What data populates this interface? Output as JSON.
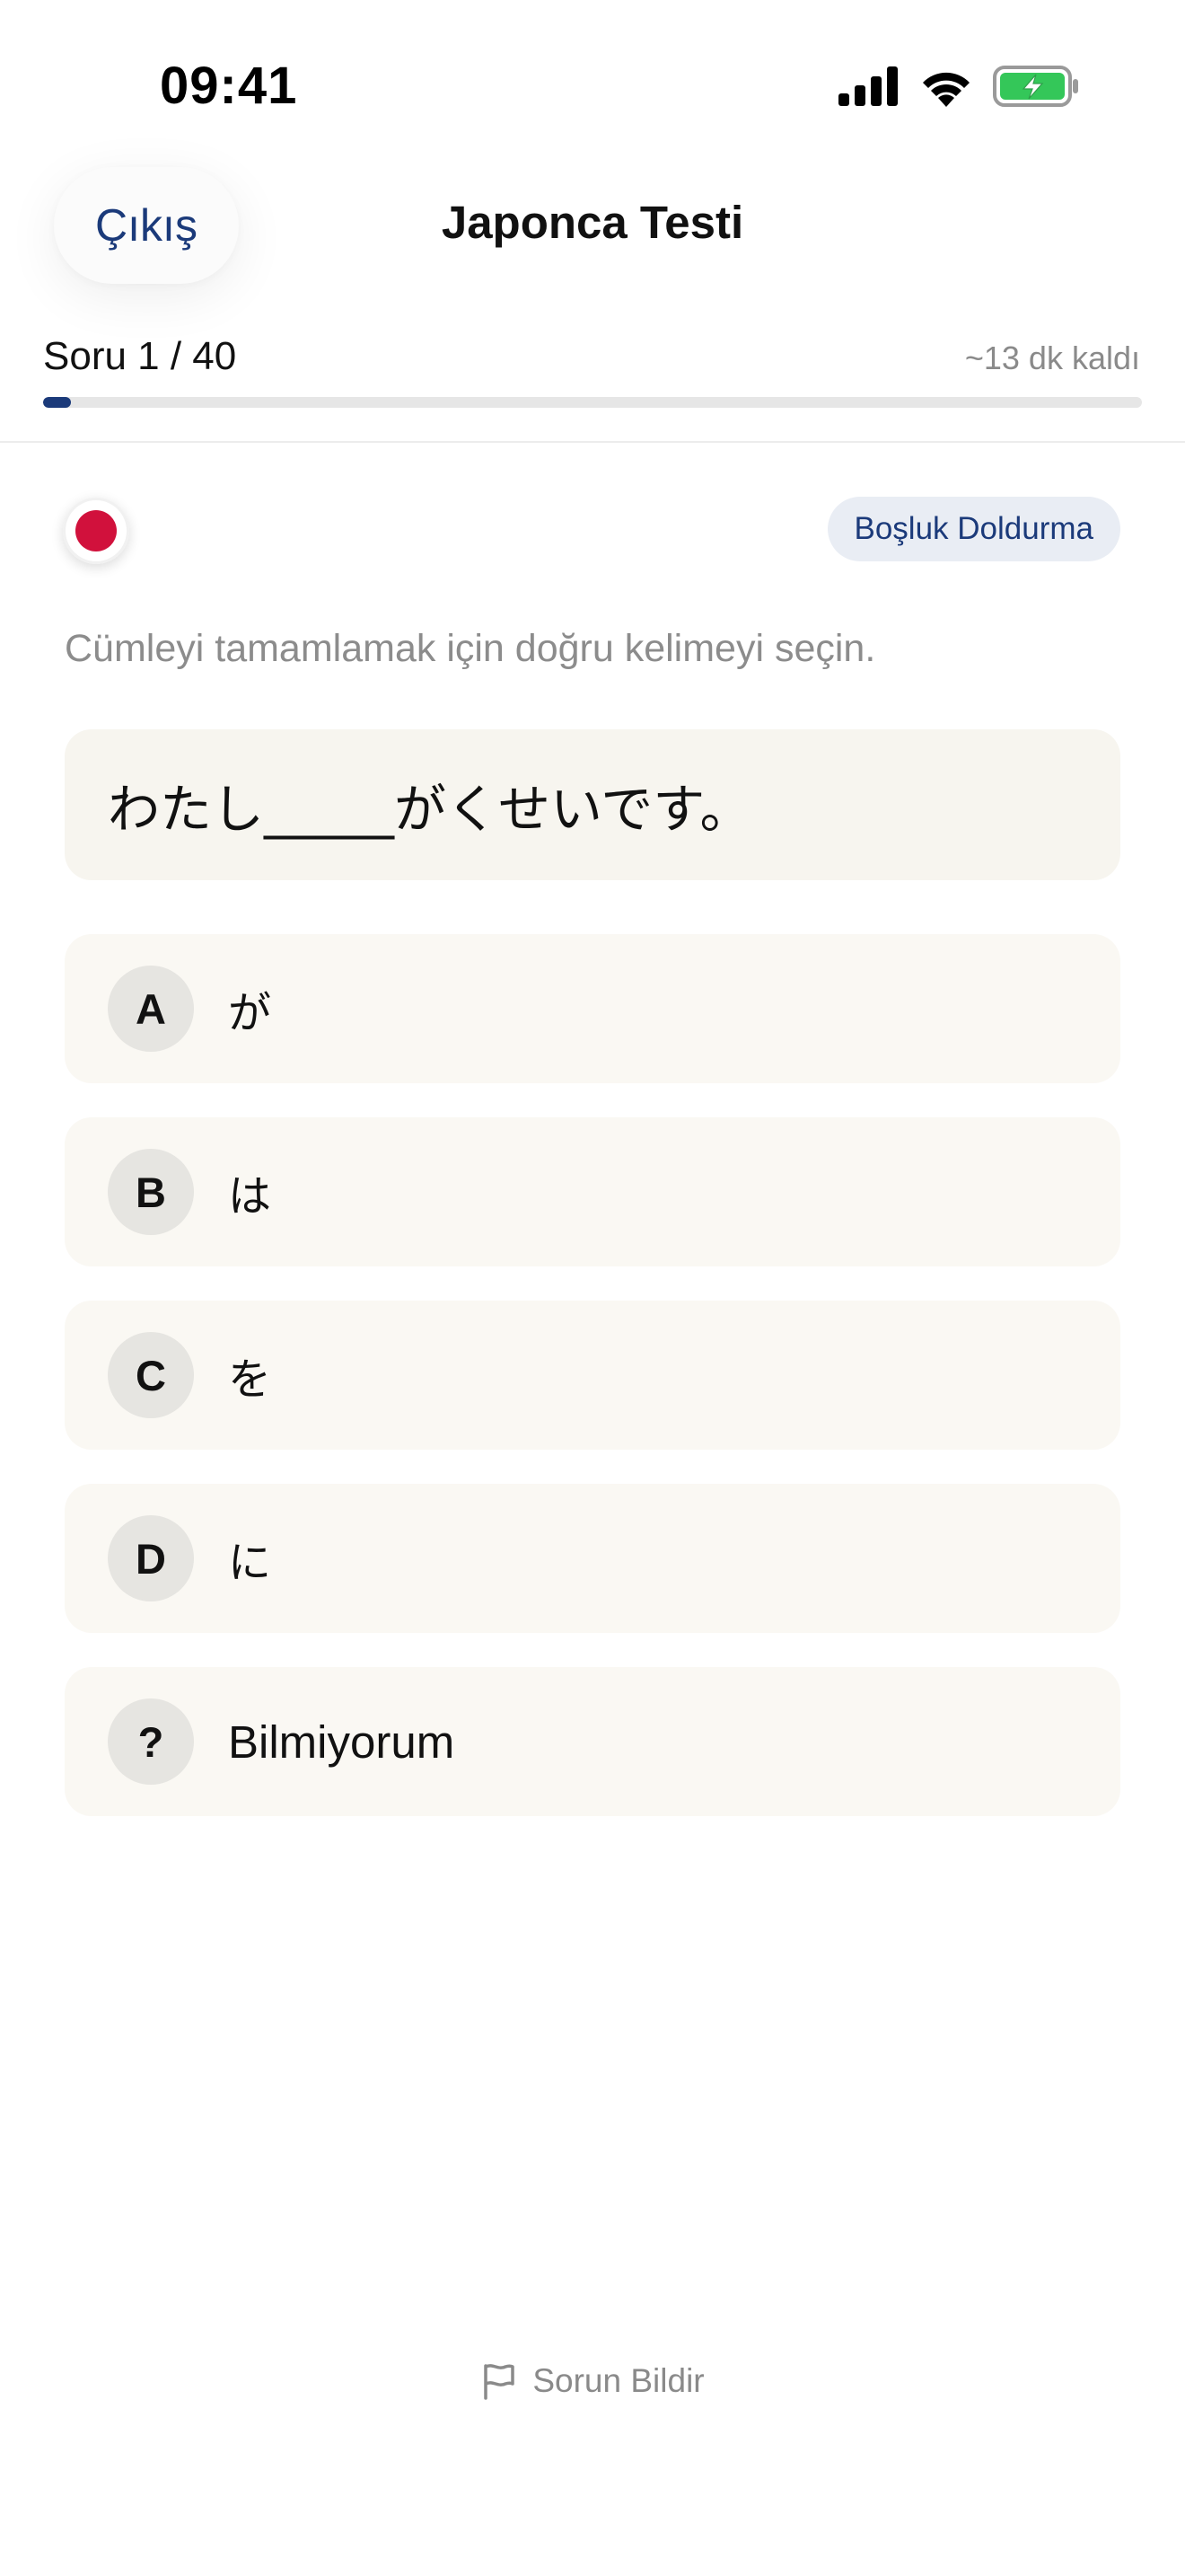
{
  "status_bar": {
    "time": "09:41",
    "icons": [
      "cellular-signal-icon",
      "wifi-icon",
      "battery-charging-icon"
    ]
  },
  "header": {
    "exit_label": "Çıkış",
    "title": "Japonca Testi"
  },
  "progress": {
    "label": "Soru 1 / 40",
    "time_remaining": "~13 dk kaldı",
    "fraction": 0.025,
    "color": "#1b3a7a"
  },
  "question": {
    "flag_icon": "japan-flag-icon",
    "type_label": "Boşluk Doldurma",
    "instruction": "Cümleyi tamamlamak için doğru kelimeyi seçin.",
    "sentence": "わたし_____がくせいです。"
  },
  "options": [
    {
      "letter": "A",
      "text": "が"
    },
    {
      "letter": "B",
      "text": "は"
    },
    {
      "letter": "C",
      "text": "を"
    },
    {
      "letter": "D",
      "text": "に"
    },
    {
      "letter": "?",
      "text": "Bilmiyorum"
    }
  ],
  "footer": {
    "report_label": "Sorun Bildir",
    "report_icon": "flag-outline-icon"
  },
  "colors": {
    "accent": "#1b3a7a",
    "flag_red": "#d1113c",
    "battery_green": "#34c759"
  }
}
